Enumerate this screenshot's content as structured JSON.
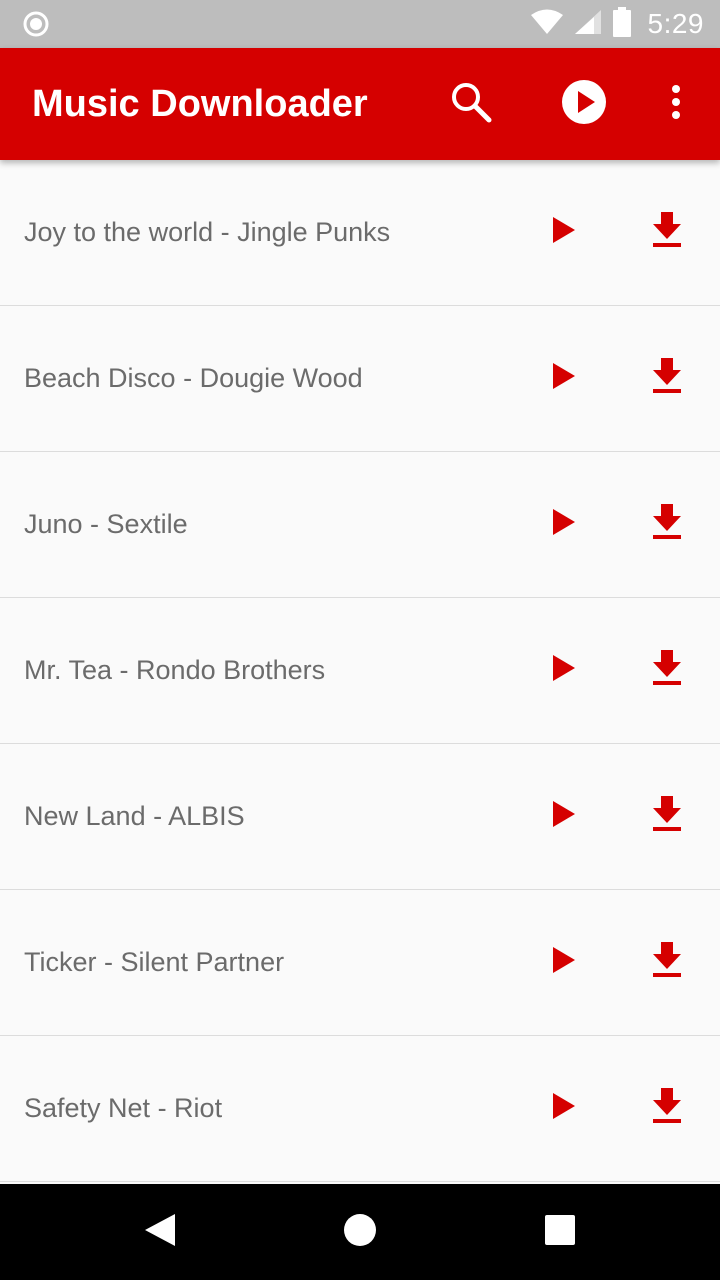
{
  "status_bar": {
    "time": "5:29",
    "icons": [
      "circle-notification-icon",
      "wifi-icon",
      "cell-signal-icon",
      "battery-icon"
    ]
  },
  "app_bar": {
    "title": "Music Downloader",
    "actions": [
      "search-icon",
      "play-circle-icon",
      "more-vert-icon"
    ]
  },
  "songs": [
    {
      "title": "Joy to the world - Jingle Punks"
    },
    {
      "title": "Beach Disco - Dougie Wood"
    },
    {
      "title": "Juno - Sextile"
    },
    {
      "title": "Mr. Tea - Rondo Brothers"
    },
    {
      "title": "New Land - ALBIS"
    },
    {
      "title": "Ticker - Silent Partner"
    },
    {
      "title": "Safety Net - Riot"
    }
  ],
  "nav_bar": {
    "buttons": [
      "back-icon",
      "home-icon",
      "recents-icon"
    ]
  },
  "colors": {
    "accent": "#d50000",
    "status_bar": "#bdbdbd",
    "list_background": "#fafafa",
    "song_text": "#6b6b6b",
    "nav_bar": "#000000"
  }
}
